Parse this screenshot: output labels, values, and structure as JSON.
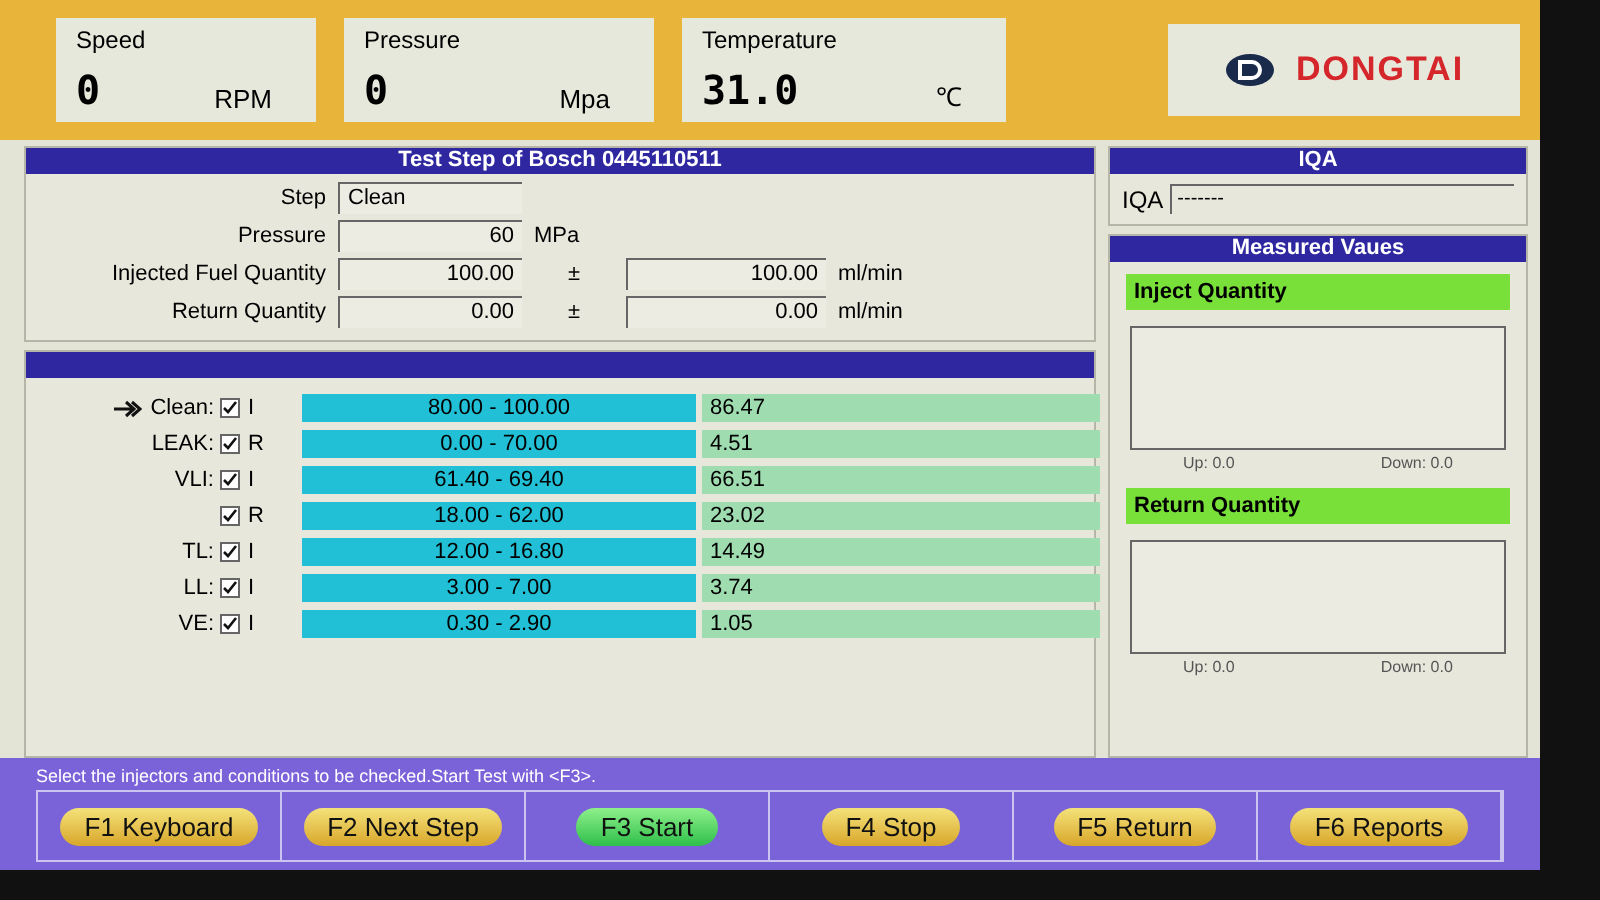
{
  "readouts": [
    {
      "label": "Speed",
      "value": "0",
      "unit": "RPM"
    },
    {
      "label": "Pressure",
      "value": "0",
      "unit": "Mpa"
    },
    {
      "label": "Temperature",
      "value": "31.0",
      "unit": "℃"
    }
  ],
  "logo": {
    "text": "DONGTAI"
  },
  "test_step": {
    "title": "Test Step of Bosch 0445110511",
    "fields": [
      {
        "kind": "text",
        "label": "Step",
        "value": "Clean"
      },
      {
        "kind": "single",
        "label": "Pressure",
        "value": "60",
        "unit": "MPa"
      },
      {
        "kind": "range",
        "label": "Injected Fuel Quantity",
        "value": "100.00",
        "sign": "±",
        "tolerance": "100.00",
        "unit": "ml/min"
      },
      {
        "kind": "range",
        "label": "Return Quantity",
        "value": "0.00",
        "sign": "±",
        "tolerance": "0.00",
        "unit": "ml/min"
      }
    ]
  },
  "results": [
    {
      "label": "Clean:",
      "checked": true,
      "channel": "I",
      "range": "80.00 - 100.00",
      "value": "86.47",
      "current": true
    },
    {
      "label": "LEAK:",
      "checked": true,
      "channel": "R",
      "range": "0.00 - 70.00",
      "value": "4.51",
      "current": false
    },
    {
      "label": "VLI:",
      "checked": true,
      "channel": "I",
      "range": "61.40 - 69.40",
      "value": "66.51",
      "current": false
    },
    {
      "checked": true,
      "channel": "R",
      "range": "18.00 - 62.00",
      "value": "23.02",
      "current": false
    },
    {
      "label": "TL:",
      "checked": true,
      "channel": "I",
      "range": "12.00 - 16.80",
      "value": "14.49",
      "current": false
    },
    {
      "label": "LL:",
      "checked": true,
      "channel": "I",
      "range": "3.00 - 7.00",
      "value": "3.74",
      "current": false
    },
    {
      "label": "VE:",
      "checked": true,
      "channel": "I",
      "range": "0.30 - 2.90",
      "value": "1.05",
      "current": false
    }
  ],
  "iqa": {
    "title": "IQA",
    "label": "IQA",
    "value": "-------"
  },
  "measured": {
    "title": "Measured Vaues",
    "charts": [
      {
        "title": "Inject Quantity",
        "up": "Up: 0.0",
        "down": "Down: 0.0"
      },
      {
        "title": "Return Quantity",
        "up": "Up: 0.0",
        "down": "Down: 0.0"
      }
    ]
  },
  "status": "Select the injectors and conditions to be checked.Start Test with <F3>.",
  "buttons": [
    {
      "label": "F1 Keyboard",
      "selected": false
    },
    {
      "label": "F2 Next Step",
      "selected": false
    },
    {
      "label": "F3 Start",
      "selected": true
    },
    {
      "label": "F4 Stop",
      "selected": false
    },
    {
      "label": "F5 Return",
      "selected": false
    },
    {
      "label": "F6 Reports",
      "selected": false
    }
  ]
}
